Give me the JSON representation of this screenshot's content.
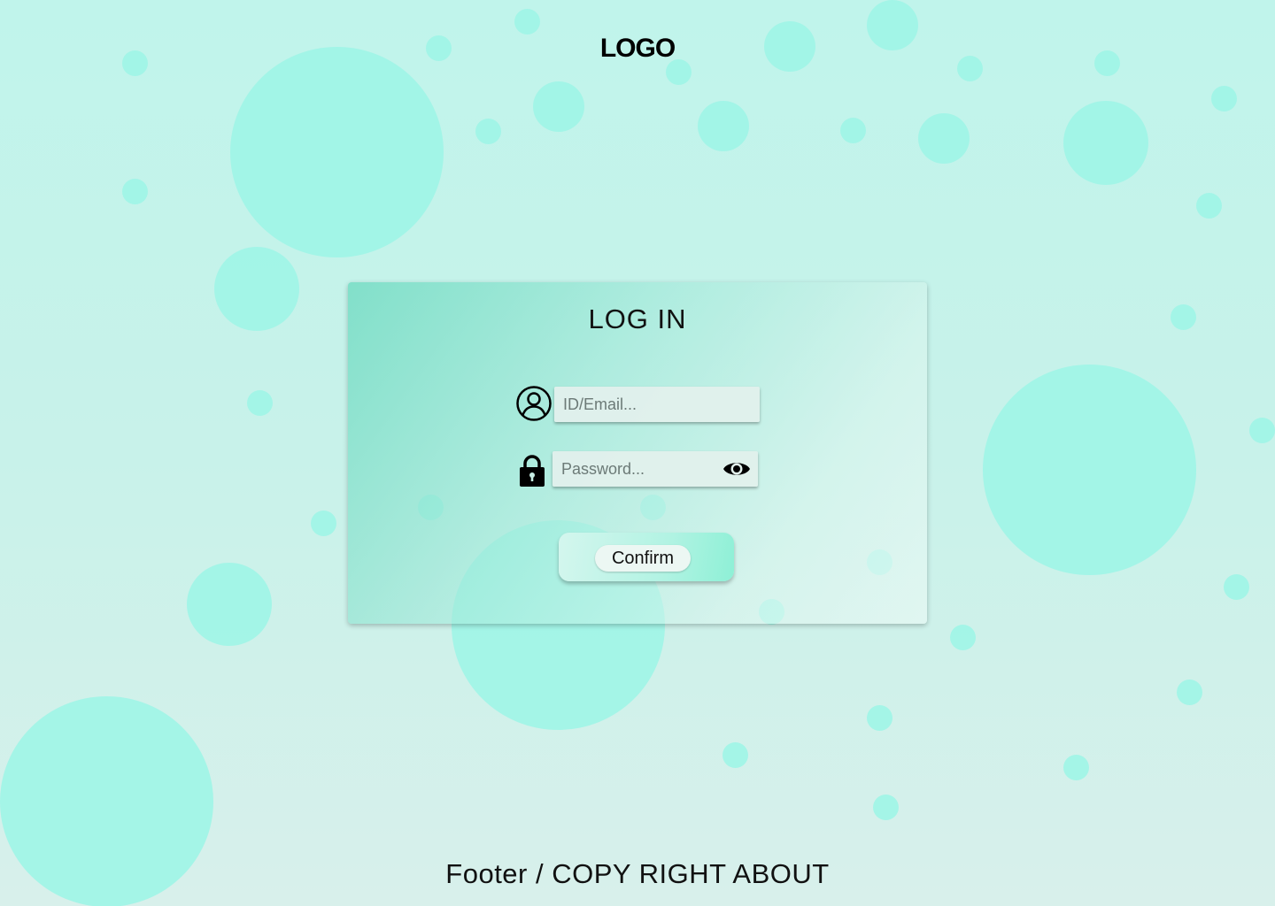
{
  "header": {
    "logo_text": "LOGO"
  },
  "login_card": {
    "title": "LOG IN",
    "email_field": {
      "placeholder": "ID/Email...",
      "value": "",
      "icon": "user-circle-icon"
    },
    "password_field": {
      "placeholder": "Password...",
      "value": "",
      "icon": "lock-icon",
      "toggle_icon": "eye-icon"
    },
    "confirm_label": "Confirm"
  },
  "footer": {
    "text": "Footer / COPY RIGHT ABOUT"
  },
  "colors": {
    "background_top": "#c0f4eb",
    "background_bottom": "#d8f0eb",
    "bubble": "#9ff5e7",
    "card_accent": "#76dcc4",
    "button_accent": "#8ef0d6"
  }
}
